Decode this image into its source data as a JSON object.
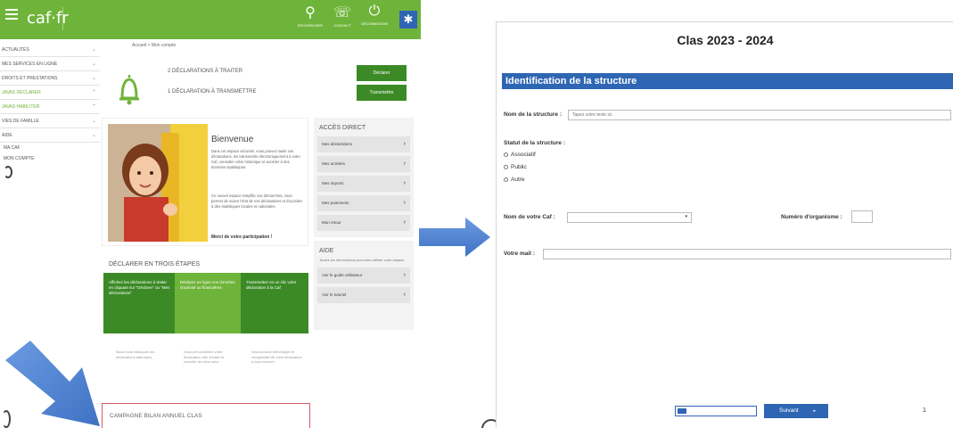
{
  "caf": {
    "logo": "caf·fr",
    "topbar_icons": [
      {
        "icon": "search-icon",
        "glyph": "⚲",
        "label": "RECHERCHER"
      },
      {
        "icon": "contact-icon",
        "glyph": "☏",
        "label": "CONTACT"
      },
      {
        "icon": "power-icon",
        "glyph": "⏻",
        "label": "DÉCONNEXION"
      }
    ],
    "accessibility_glyph": "✱",
    "sidebar": [
      {
        "label": "ACTUALITÉS",
        "chev": "⌄"
      },
      {
        "label": "MES SERVICES EN LIGNE",
        "chev": "⌄"
      },
      {
        "label": "DROITS ET PRESTATIONS",
        "chev": "⌄"
      },
      {
        "label": "JAVAS DECLARER",
        "chev": "⌃"
      },
      {
        "label": "JAVAS HABILITER",
        "chev": "⌃"
      },
      {
        "label": "VIES DE FAMILLE",
        "chev": "⌄"
      },
      {
        "label": "AIDE",
        "chev": "⌄"
      }
    ],
    "sidebar_sub": [
      "MA CAF",
      "MON COMPTE"
    ],
    "breadcrumb": "Accueil > Mon compte",
    "declarations": [
      {
        "text": "2 DÉCLARATIONS À TRAITER",
        "button": "Déclarer"
      },
      {
        "text": "1 DÉCLARATION À TRANSMETTRE",
        "button": "Transmettre"
      }
    ],
    "welcome": {
      "title": "Bienvenue",
      "p1": "Dans cet espace sécurisé, vous pouvez saisir vos déclarations, les transmettre électroniquement à votre Caf, consulter votre historique et accéder à des données statistiques.",
      "p2": "Ce nouvel espace simplifie vos démarches, vous permet de suivre l'état de vos déclarations et d'accéder à des statistiques locales et nationales.",
      "link": "Merci de votre participation !"
    },
    "direct": {
      "title": "ACCÈS DIRECT",
      "items": [
        "Mes déclarations",
        "Mes activités",
        "Mes imports",
        "Mes paiements",
        "Mon retour"
      ]
    },
    "aide": {
      "title": "AIDE",
      "text": "Toutes les informations pour bien utiliser votre espace",
      "items": [
        "Voir le guide utilisateur",
        "Voir le tutoriel"
      ]
    },
    "steps": {
      "title": "DÉCLARER EN TROIS ÉTAPES",
      "items": [
        "Affichez les déclarations à traiter en cliquant sur \"Déclarer\" ou \"Mes déclarations\"",
        "Déclarez en ligne vos données d'activité ou financières",
        "Transmettez en un clic votre déclaration à la Caf"
      ],
      "descriptions": [
        "Nous vous indiquons les déclarations attendues.",
        "Vous pré-contrôlez votre déclaration afin d'éviter le moindre de votre suivi.",
        "Vous pouvez télécharger le récapitulatif de votre déclaration à tout moment."
      ]
    },
    "campagne": "CAMPAGNE BILAN ANNUEL CLAS"
  },
  "form": {
    "title": "Clas 2023 - 2024",
    "section": "Identification de la structure",
    "nom_label": "Nom de la structure :",
    "nom_placeholder": "Tapez votre texte ici",
    "statut_label": "Statut de la structure :",
    "statut_options": [
      "Associatif",
      "Public",
      "Autre"
    ],
    "caf_label": "Nom de votre Caf :",
    "caf_value": "",
    "caf_caret": "▾",
    "numero_label": "Numéro d'organisme :",
    "mail_label": "Votre mail :",
    "progress": 0.12,
    "next_button": "Suivant",
    "next_caret": "▸",
    "page_number": "1"
  },
  "colors": {
    "caf_green": "#6fb43a",
    "caf_dark_green": "#3c8a26",
    "form_blue": "#2f66b3",
    "arrow_blue": "#4a7fd0"
  }
}
